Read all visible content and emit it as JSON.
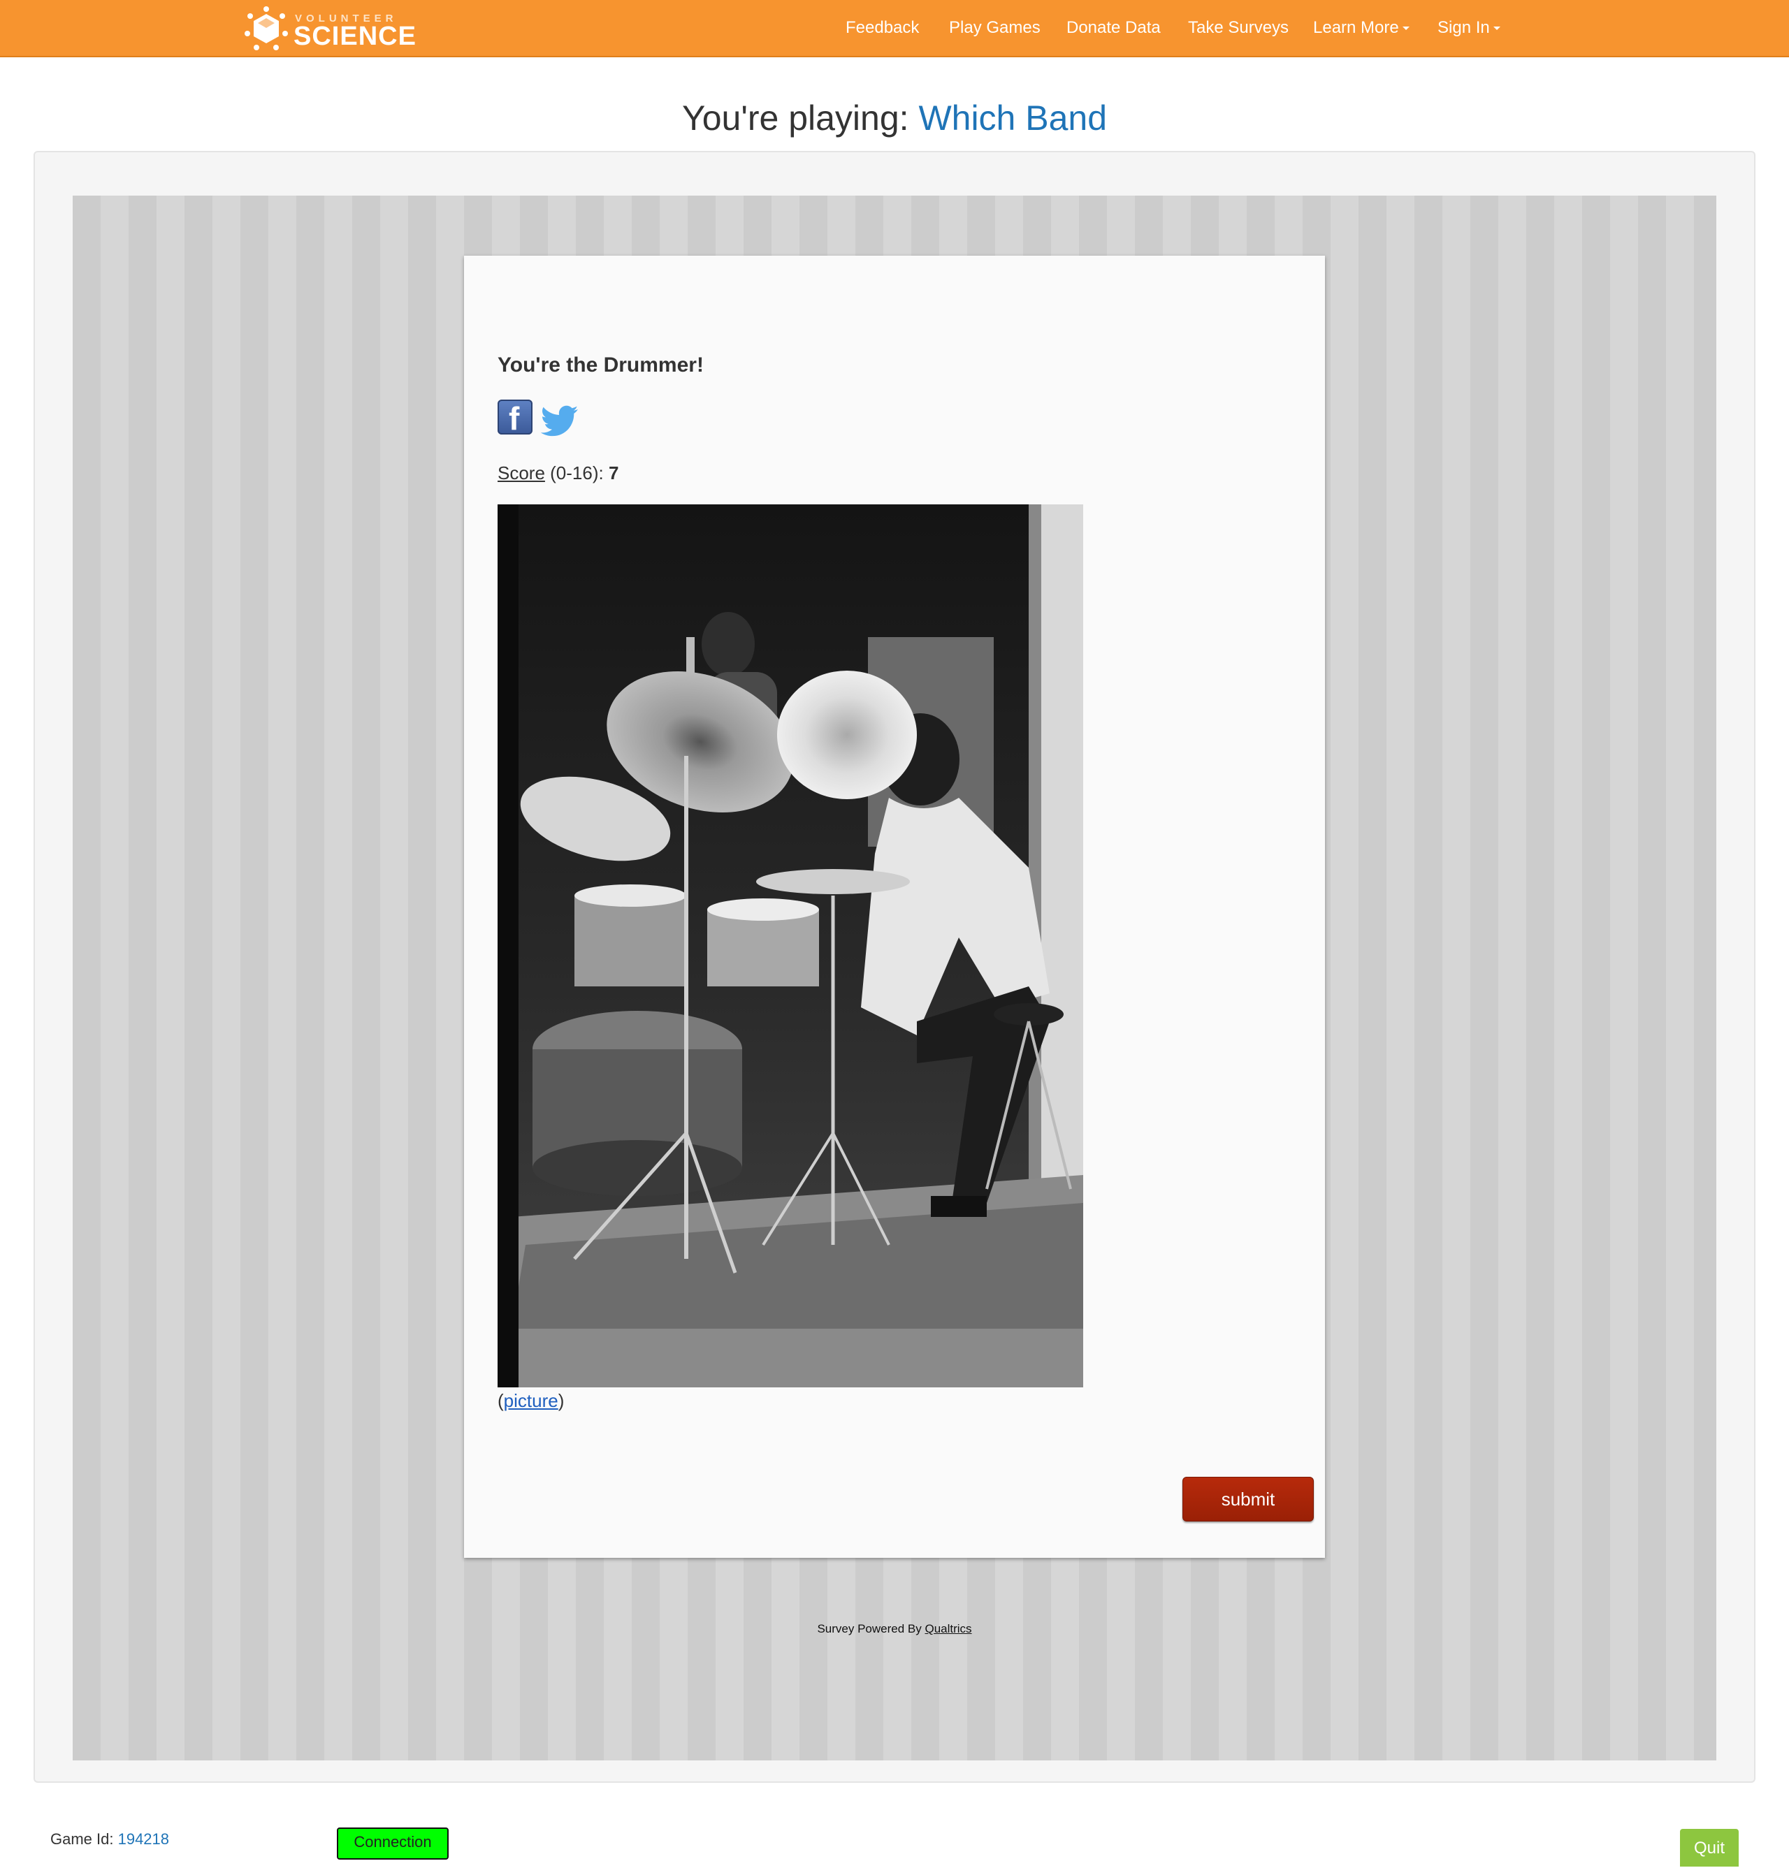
{
  "navbar": {
    "brand_small": "VOLUNTEER",
    "brand_big": "SCIENCE",
    "items": [
      {
        "label": "Feedback"
      },
      {
        "label": "Play Games"
      },
      {
        "label": "Donate Data"
      },
      {
        "label": "Take Surveys"
      },
      {
        "label": "Learn More",
        "dropdown": true
      },
      {
        "label": "Sign In",
        "dropdown": true
      }
    ]
  },
  "heading": {
    "prefix": "You're playing: ",
    "game_name": "Which Band"
  },
  "survey": {
    "result_title": "You're the Drummer!",
    "social": [
      "facebook-icon",
      "twitter-icon"
    ],
    "score_label": "Score",
    "score_range": " (0-16): ",
    "score_value": "7",
    "photo_credit_open": "(",
    "photo_credit_link": "picture",
    "photo_credit_close": ")",
    "submit_label": "submit"
  },
  "powered_by": {
    "prefix": "Survey Powered By ",
    "brand": "Qualtrics"
  },
  "footer": {
    "game_id_label": "Game Id: ",
    "game_id_value": "194218",
    "connection_label": "Connection",
    "quit_label": "Quit"
  },
  "colors": {
    "navbar": "#f7942f",
    "link": "#1f74b7",
    "submit": "#a82408",
    "connection": "#00ff00",
    "quit": "#8dc63f"
  }
}
